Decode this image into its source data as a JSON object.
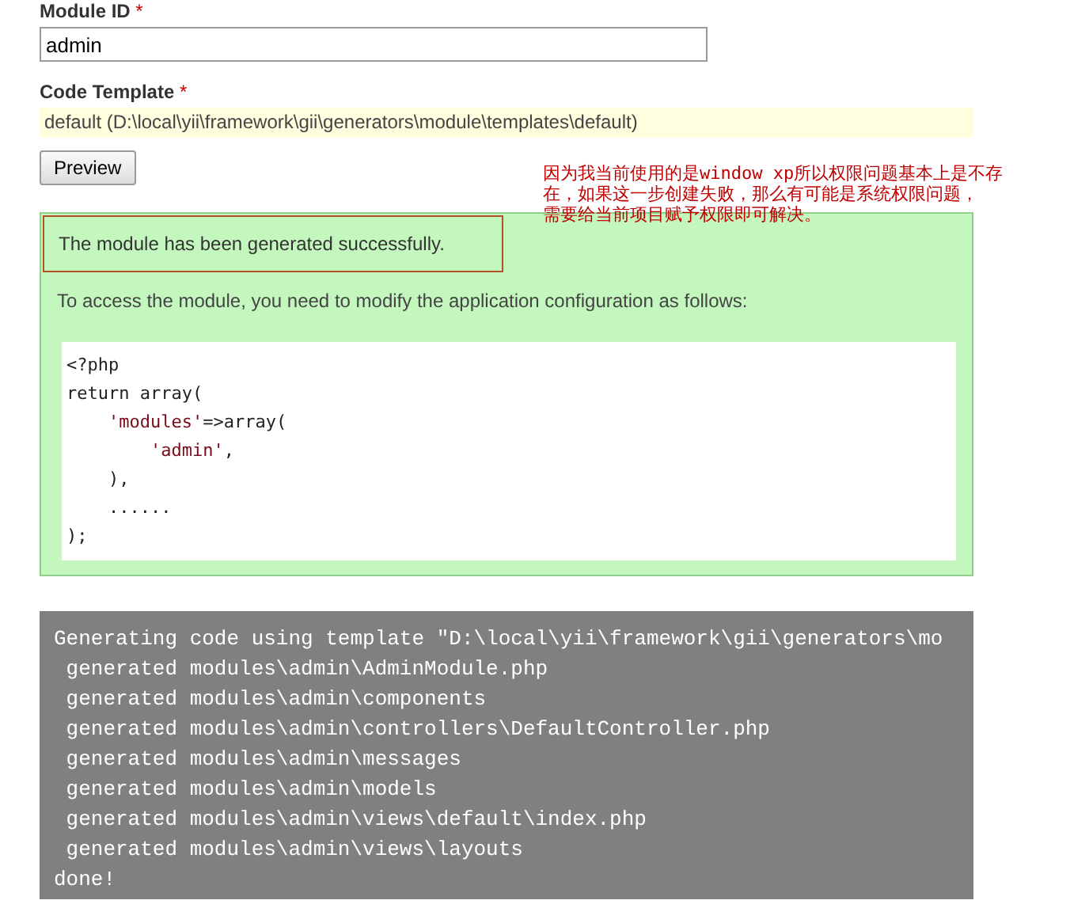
{
  "module_id": {
    "label": "Module ID",
    "required_mark": "*",
    "value": "admin"
  },
  "code_template": {
    "label": "Code Template",
    "required_mark": "*",
    "value": "default (D:\\local\\yii\\framework\\gii\\generators\\module\\templates\\default)"
  },
  "preview_button": "Preview",
  "annotation": {
    "lines": [
      "因为我当前使用的是window xp所以权限问题基本上是不存",
      "在，如果这一步创建失败，那么有可能是系统权限问题，",
      "需要给当前项目赋予权限即可解决。"
    ]
  },
  "result": {
    "success": "The module has been generated successfully.",
    "success_highlighted": true,
    "instructions": "To access the module, you need to modify the application configuration as follows:",
    "code_lines": [
      [
        {
          "kind": "plain",
          "text": "<?php"
        }
      ],
      [
        {
          "kind": "plain",
          "text": "return array("
        }
      ],
      [
        {
          "kind": "string",
          "text": "    'modules'"
        },
        {
          "kind": "plain",
          "text": "=>array("
        }
      ],
      [
        {
          "kind": "string",
          "text": "        'admin'"
        },
        {
          "kind": "plain",
          "text": ","
        }
      ],
      [
        {
          "kind": "plain",
          "text": "    ),"
        }
      ],
      [
        {
          "kind": "plain",
          "text": "    ......"
        }
      ],
      [
        {
          "kind": "plain",
          "text": ");"
        }
      ]
    ]
  },
  "log_lines": [
    "Generating code using template \"D:\\local\\yii\\framework\\gii\\generators\\mo",
    " generated modules\\admin\\AdminModule.php",
    " generated modules\\admin\\components",
    " generated modules\\admin\\controllers\\DefaultController.php",
    " generated modules\\admin\\messages",
    " generated modules\\admin\\models",
    " generated modules\\admin\\views\\default\\index.php",
    " generated modules\\admin\\views\\layouts",
    "done!"
  ]
}
